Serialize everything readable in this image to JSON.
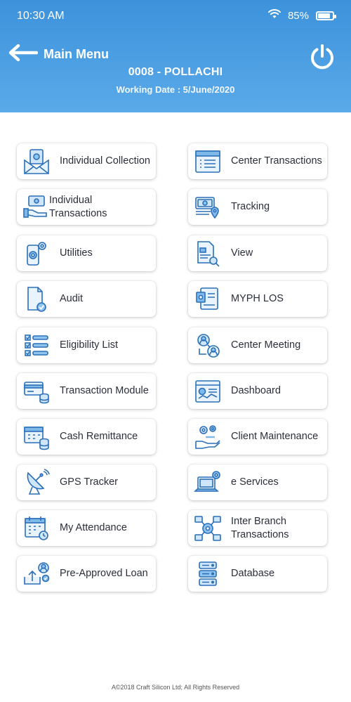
{
  "status": {
    "time": "10:30 AM",
    "battery": "85%",
    "battery_level": 0.85
  },
  "header": {
    "back_label": "Main Menu",
    "branch": "0008 - POLLACHI",
    "working_date": "Working Date : 5/June/2020",
    "accent": "#3d92db"
  },
  "menu": {
    "individual_collection": "Individual Collection",
    "center_transactions": "Center Transactions",
    "individual_transactions": "Individual Transactions",
    "tracking": "Tracking",
    "utilities": "Utilities",
    "view": "View",
    "audit": "Audit",
    "myph_los": "MYPH LOS",
    "eligibility_list": "Eligibility List",
    "center_meeting": "Center Meeting",
    "transaction_module": "Transaction Module",
    "dashboard": "Dashboard",
    "cash_remittance": "Cash Remittance",
    "client_maintenance": "Client Maintenance",
    "gps_tracker": "GPS Tracker",
    "e_services": "e Services",
    "my_attendance": "My Attendance",
    "inter_branch_transactions_1": "Inter Branch",
    "inter_branch_transactions_2": "Transactions",
    "pre_approved_loan": "Pre-Approved Loan",
    "database": "Database"
  },
  "icons": {
    "individual_collection": "money-envelope-icon",
    "center_transactions": "ledger-list-icon",
    "individual_transactions": "hand-cash-icon",
    "tracking": "cash-location-icon",
    "utilities": "phone-gear-icon",
    "view": "document-search-icon",
    "audit": "document-check-icon",
    "myph_los": "loan-form-icon",
    "eligibility_list": "checklist-icon",
    "center_meeting": "group-users-icon",
    "transaction_module": "cards-coins-icon",
    "dashboard": "dashboard-chart-icon",
    "cash_remittance": "calendar-coins-icon",
    "client_maintenance": "hand-gears-icon",
    "gps_tracker": "satellite-dish-icon",
    "e_services": "laptop-gear-icon",
    "my_attendance": "calendar-clock-icon",
    "inter_branch_transactions": "network-transfer-icon",
    "pre_approved_loan": "user-upload-icon",
    "database": "server-rack-icon"
  },
  "footer": "A©2018 Craft Silicon Ltd; All Rights Reserved"
}
